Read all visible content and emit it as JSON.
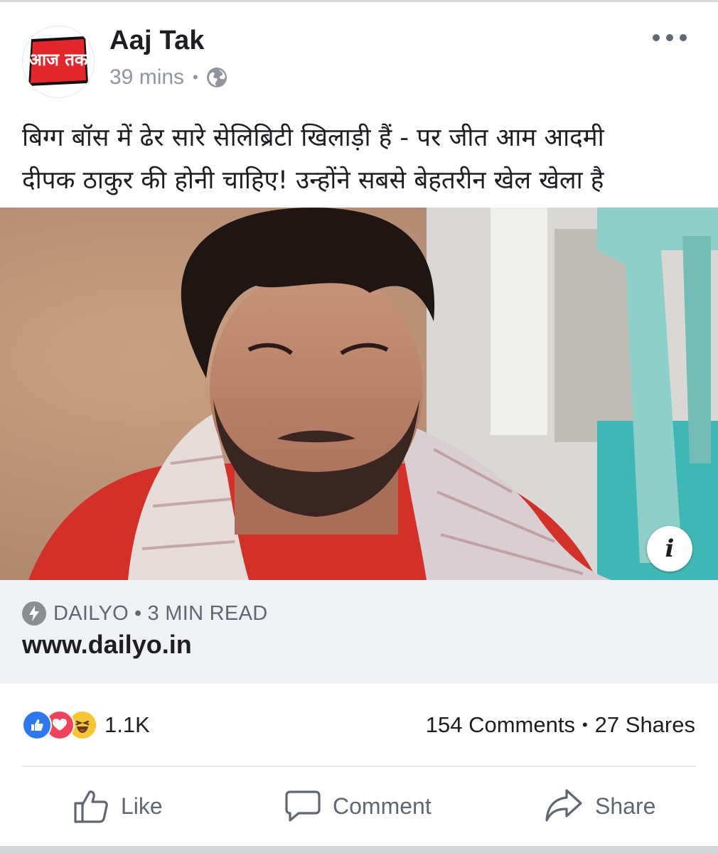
{
  "post": {
    "page_name": "Aaj Tak",
    "logo_text": "आज तक",
    "time": "39 mins",
    "separator": "•",
    "audience_icon": "globe-icon",
    "more_icon": "more-options-icon",
    "text": "बिग्ग बॉस में ढेर सारे सेलिब्रिटी खिलाड़ी हैं - पर जीत आम आदमी\nदीपक ठाकुर की होनी चाहिए! उन्होंने सबसे बेहतरीन खेल खेला है"
  },
  "link": {
    "source": "DAILYO",
    "separator": "•",
    "read_time": "3 MIN READ",
    "url": "www.dailyo.in",
    "info_label": "i"
  },
  "stats": {
    "reaction_icons": [
      "like-reaction-icon",
      "love-reaction-icon",
      "haha-reaction-icon"
    ],
    "reaction_count": "1.1K",
    "comments": "154 Comments",
    "separator": "•",
    "shares": "27 Shares"
  },
  "actions": {
    "like": "Like",
    "comment": "Comment",
    "share": "Share"
  },
  "colors": {
    "like_blue": "#2e78ef",
    "love_red": "#f0425a",
    "haha_yellow": "#f7c433",
    "logo_red": "#e3262b",
    "muted_text": "#90949c",
    "link_bg": "#f0f1f4"
  }
}
